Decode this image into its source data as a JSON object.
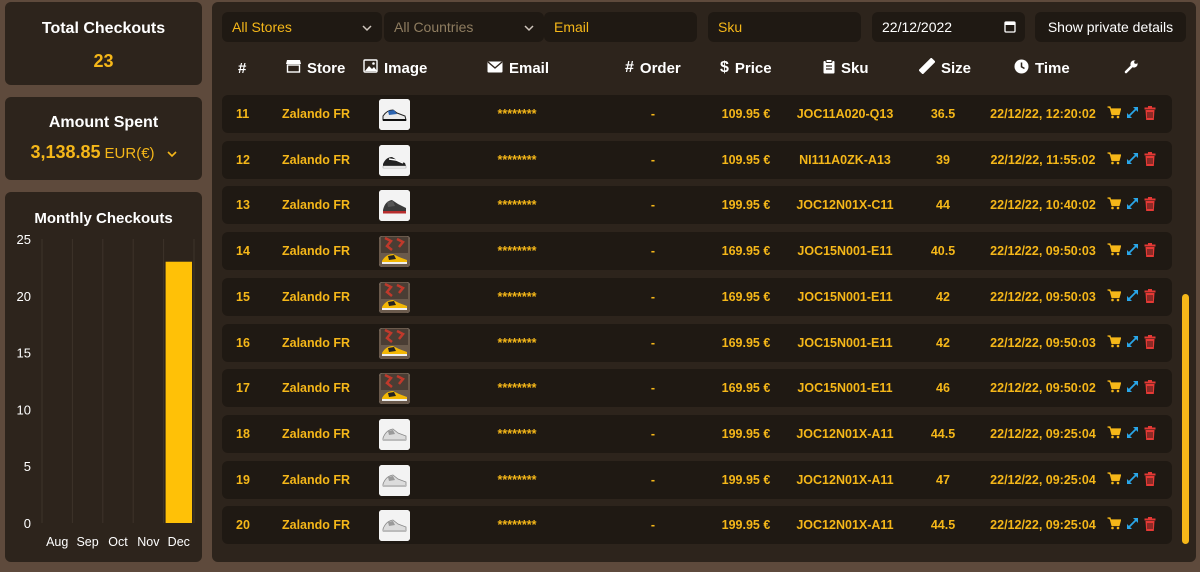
{
  "stats": {
    "total_checkouts": {
      "label": "Total Checkouts",
      "value": "23"
    },
    "amount_spent": {
      "label": "Amount Spent",
      "value": "3,138.85",
      "currency": "EUR(€)"
    }
  },
  "monthly": {
    "title": "Monthly Checkouts"
  },
  "chart_data": {
    "type": "bar",
    "title": "Monthly Checkouts",
    "categories": [
      "Aug",
      "Sep",
      "Oct",
      "Nov",
      "Dec"
    ],
    "values": [
      0,
      0,
      0,
      0,
      23
    ],
    "yticks": [
      "0",
      "5",
      "10",
      "15",
      "20",
      "25"
    ],
    "ylim": [
      0,
      25
    ],
    "grid": "vertical",
    "color": "#ffc107"
  },
  "filters": {
    "stores": "All Stores",
    "countries": "All Countries",
    "email_placeholder": "Email",
    "sku_placeholder": "Sku",
    "date": "22/12/2022",
    "private_button": "Show private details"
  },
  "columns": {
    "num": "#",
    "store": "Store",
    "image": "Image",
    "email": "Email",
    "order": "Order",
    "price": "Price",
    "sku": "Sku",
    "size": "Size",
    "time": "Time"
  },
  "rows": [
    {
      "num": "11",
      "store": "Zalando FR",
      "email": "********",
      "order": "-",
      "price": "109.95 €",
      "sku": "JOC11A020-Q13",
      "size": "36.5",
      "time": "22/12/22, 12:20:02",
      "shoe": "blue"
    },
    {
      "num": "12",
      "store": "Zalando FR",
      "email": "********",
      "order": "-",
      "price": "109.95 €",
      "sku": "NI111A0ZK-A13",
      "size": "39",
      "time": "22/12/22, 11:55:02",
      "shoe": "black"
    },
    {
      "num": "13",
      "store": "Zalando FR",
      "email": "********",
      "order": "-",
      "price": "199.95 €",
      "sku": "JOC12N01X-C11",
      "size": "44",
      "time": "22/12/22, 10:40:02",
      "shoe": "dark"
    },
    {
      "num": "14",
      "store": "Zalando FR",
      "email": "********",
      "order": "-",
      "price": "169.95 €",
      "sku": "JOC15N001-E11",
      "size": "40.5",
      "time": "22/12/22, 09:50:03",
      "shoe": "taxi"
    },
    {
      "num": "15",
      "store": "Zalando FR",
      "email": "********",
      "order": "-",
      "price": "169.95 €",
      "sku": "JOC15N001-E11",
      "size": "42",
      "time": "22/12/22, 09:50:03",
      "shoe": "taxi"
    },
    {
      "num": "16",
      "store": "Zalando FR",
      "email": "********",
      "order": "-",
      "price": "169.95 €",
      "sku": "JOC15N001-E11",
      "size": "42",
      "time": "22/12/22, 09:50:03",
      "shoe": "taxi"
    },
    {
      "num": "17",
      "store": "Zalando FR",
      "email": "********",
      "order": "-",
      "price": "169.95 €",
      "sku": "JOC15N001-E11",
      "size": "46",
      "time": "22/12/22, 09:50:02",
      "shoe": "taxi"
    },
    {
      "num": "18",
      "store": "Zalando FR",
      "email": "********",
      "order": "-",
      "price": "199.95 €",
      "sku": "JOC12N01X-A11",
      "size": "44.5",
      "time": "22/12/22, 09:25:04",
      "shoe": "white"
    },
    {
      "num": "19",
      "store": "Zalando FR",
      "email": "********",
      "order": "-",
      "price": "199.95 €",
      "sku": "JOC12N01X-A11",
      "size": "47",
      "time": "22/12/22, 09:25:04",
      "shoe": "white"
    },
    {
      "num": "20",
      "store": "Zalando FR",
      "email": "********",
      "order": "-",
      "price": "199.95 €",
      "sku": "JOC12N01X-A11",
      "size": "44.5",
      "time": "22/12/22, 09:25:04",
      "shoe": "white"
    }
  ],
  "colors": {
    "accent": "#f5b719",
    "bar": "#ffc107",
    "expand": "#2aa6e8",
    "delete": "#e53935"
  },
  "icons": {
    "actions": [
      "cart-icon",
      "expand-icon",
      "trash-icon"
    ]
  }
}
